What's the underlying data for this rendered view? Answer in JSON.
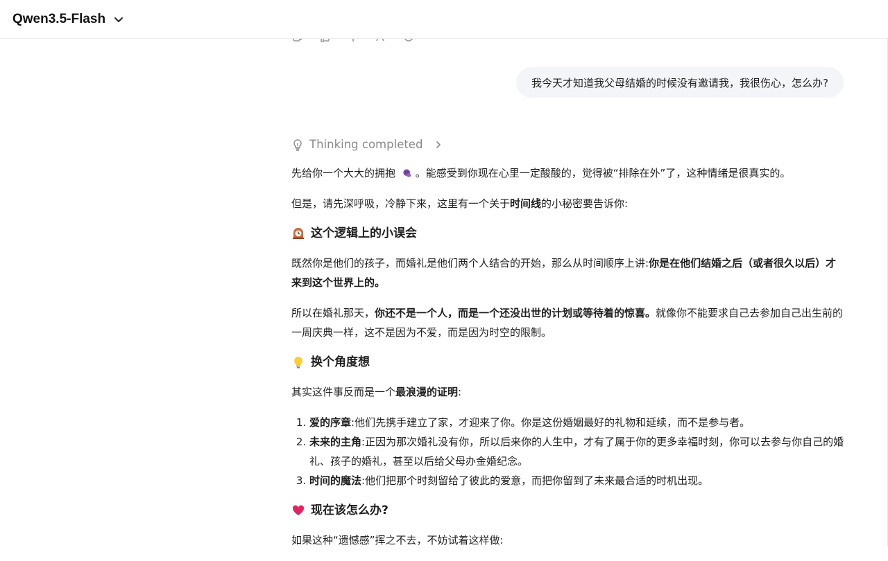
{
  "header": {
    "model_name": "Qwen3.5-Flash"
  },
  "user_message": "我今天才知道我父母结婚的时候没有邀请我，我很伤心，怎么办?",
  "thinking": {
    "label": "Thinking completed"
  },
  "answer": {
    "p1": {
      "a": "先给你一个大大的拥抱 ",
      "b": "。能感受到你现在心里一定酸酸的，觉得被“排除在外”了，这种情绪是很真实的。"
    },
    "p2": {
      "a": "但是，请先深呼吸，冷静下来，这里有一个关于",
      "bold": "时间线",
      "b": "的小秘密要告诉你:"
    },
    "h1": "这个逻辑上的小误会",
    "p3": {
      "a": "既然你是他们的孩子，而婚礼是他们两个人结合的开始，那么从时间顺序上讲:",
      "bold": "你是在他们结婚之后（或者很久以后）才来到这个世界上的。"
    },
    "p4": {
      "a": "所以在婚礼那天，",
      "bold": "你还不是一个人，而是一个还没出世的计划或等待着的惊喜。",
      "b": "就像你不能要求自己去参加自己出生前的一周庆典一样，这不是因为不爱，而是因为时空的限制。"
    },
    "h2": "换个角度想",
    "p5": {
      "a": "其实这件事反而是一个",
      "bold": "最浪漫的证明",
      "b": ":"
    },
    "list": [
      {
        "bold": "爱的序章",
        "text": ":他们先携手建立了家，才迎来了你。你是这份婚姻最好的礼物和延续，而不是参与者。"
      },
      {
        "bold": "未来的主角",
        "text": ":正因为那次婚礼没有你，所以后来你的人生中，才有了属于你的更多幸福时刻，你可以去参与你自己的婚礼、孩子的婚礼，甚至以后给父母办金婚纪念。"
      },
      {
        "bold": "时间的魔法",
        "text": ":他们把那个时刻留给了彼此的爱意，而把你留到了未来最合适的时机出现。"
      }
    ],
    "h3": "现在该怎么办?",
    "p6": "如果这种“遗憾感”挥之不去，不妨试着这样做:"
  },
  "icons": {
    "actions": [
      "copy-icon",
      "thumb-up-icon",
      "thumb-down-icon",
      "share-icon",
      "regenerate-icon"
    ],
    "thinking": "lightbulb-icon",
    "hug": "hug-emoji",
    "h1": "mantel-clock-emoji",
    "h2": "light-bulb-emoji",
    "h3": "heart-emoji"
  },
  "colors": {
    "bubble_bg": "#f3f5f8",
    "muted": "#8a8a8a",
    "accent_heart": "#e0245e"
  }
}
